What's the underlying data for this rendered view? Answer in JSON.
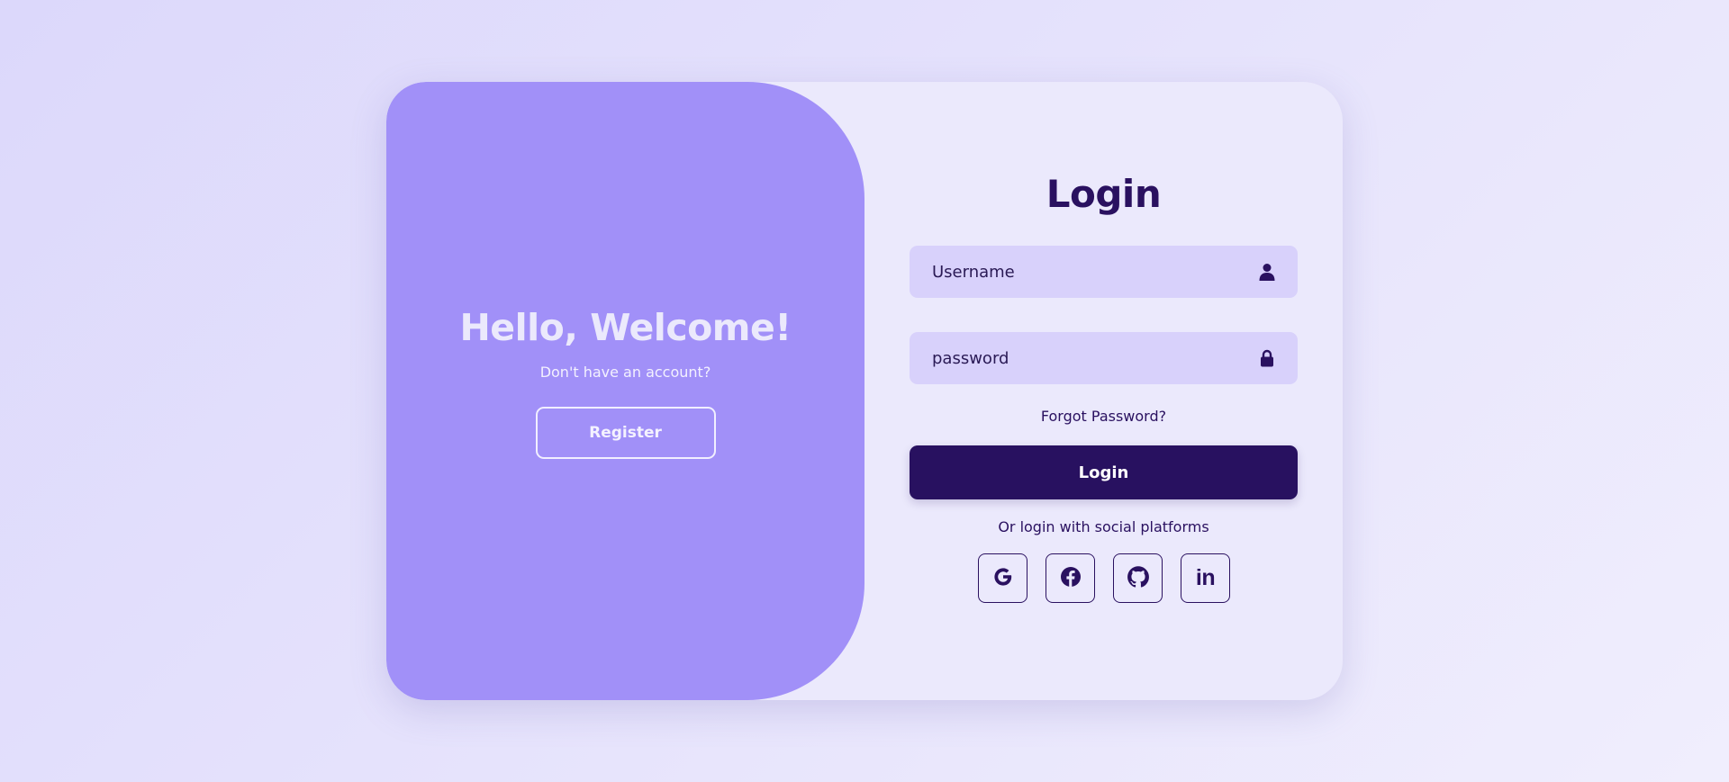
{
  "welcome": {
    "title": "Hello, Welcome!",
    "subtitle": "Don't have an account?",
    "register_label": "Register"
  },
  "login": {
    "title": "Login",
    "username_placeholder": "Username",
    "password_placeholder": "password",
    "forgot_label": "Forgot Password?",
    "submit_label": "Login",
    "social_text": "Or login with social platforms",
    "socials": [
      {
        "icon": "google-icon",
        "label": "G"
      },
      {
        "icon": "facebook-icon"
      },
      {
        "icon": "github-icon"
      },
      {
        "icon": "linkedin-icon",
        "label": "in"
      }
    ]
  },
  "colors": {
    "accent_panel": "#a190f8",
    "primary_dark": "#281160",
    "input_bg": "#d8d1fb",
    "card_bg": "#ebe9fc"
  }
}
